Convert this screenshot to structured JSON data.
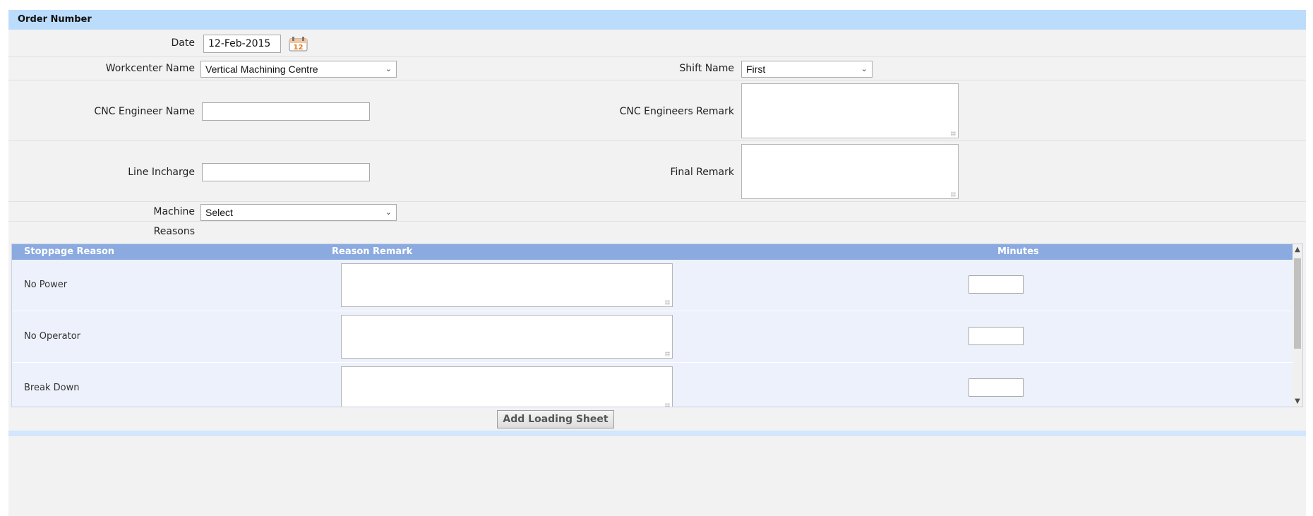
{
  "header": {
    "title": "Order Number"
  },
  "form": {
    "date_label": "Date",
    "date_value": "12-Feb-2015",
    "calendar_icon_text": "12",
    "workcenter_label": "Workcenter Name",
    "workcenter_value": "Vertical Machining Centre",
    "shift_label": "Shift Name",
    "shift_value": "First",
    "cnc_engineer_label": "CNC Engineer Name",
    "cnc_engineer_value": "",
    "cnc_remark_label": "CNC Engineers Remark",
    "cnc_remark_value": "",
    "line_incharge_label": "Line Incharge",
    "line_incharge_value": "",
    "final_remark_label": "Final Remark",
    "final_remark_value": "",
    "machine_label": "Machine",
    "machine_value": "Select",
    "reasons_label": "Reasons"
  },
  "grid": {
    "columns": [
      "Stoppage Reason",
      "Reason Remark",
      "Minutes"
    ],
    "rows": [
      {
        "reason": "No Power",
        "remark": "",
        "minutes": ""
      },
      {
        "reason": "No Operator",
        "remark": "",
        "minutes": ""
      },
      {
        "reason": "Break Down",
        "remark": "",
        "minutes": ""
      }
    ]
  },
  "actions": {
    "add_label": "Add Loading Sheet"
  },
  "icons": {
    "dropdown": "chevron-down-icon",
    "calendar": "calendar-icon",
    "scroll_up": "scroll-up-arrow-icon",
    "scroll_down": "scroll-down-arrow-icon"
  },
  "colors": {
    "header_bg": "#bcdcfb",
    "grid_header_bg": "#8aaae0",
    "alt_row_bg": "#edf1fb"
  }
}
